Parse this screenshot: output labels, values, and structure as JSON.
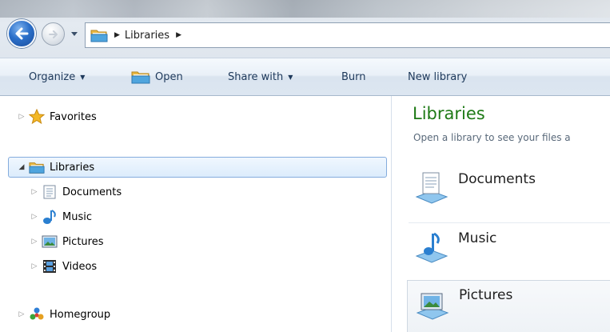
{
  "address_bar": {
    "back_button": "back",
    "forward_button": "forward",
    "breadcrumb": [
      "Libraries"
    ]
  },
  "toolbar": {
    "organize_label": "Organize",
    "open_label": "Open",
    "share_with_label": "Share with",
    "burn_label": "Burn",
    "new_library_label": "New library"
  },
  "nav_pane": {
    "favorites": "Favorites",
    "libraries": "Libraries",
    "library_children": [
      "Documents",
      "Music",
      "Pictures",
      "Videos"
    ],
    "homegroup": "Homegroup"
  },
  "content": {
    "title": "Libraries",
    "subtitle": "Open a library to see your files a",
    "libraries": [
      "Documents",
      "Music",
      "Pictures"
    ]
  },
  "colors": {
    "title_green": "#1e7a16",
    "toolbar_text": "#1e395b",
    "selection_border": "#84acdd"
  }
}
